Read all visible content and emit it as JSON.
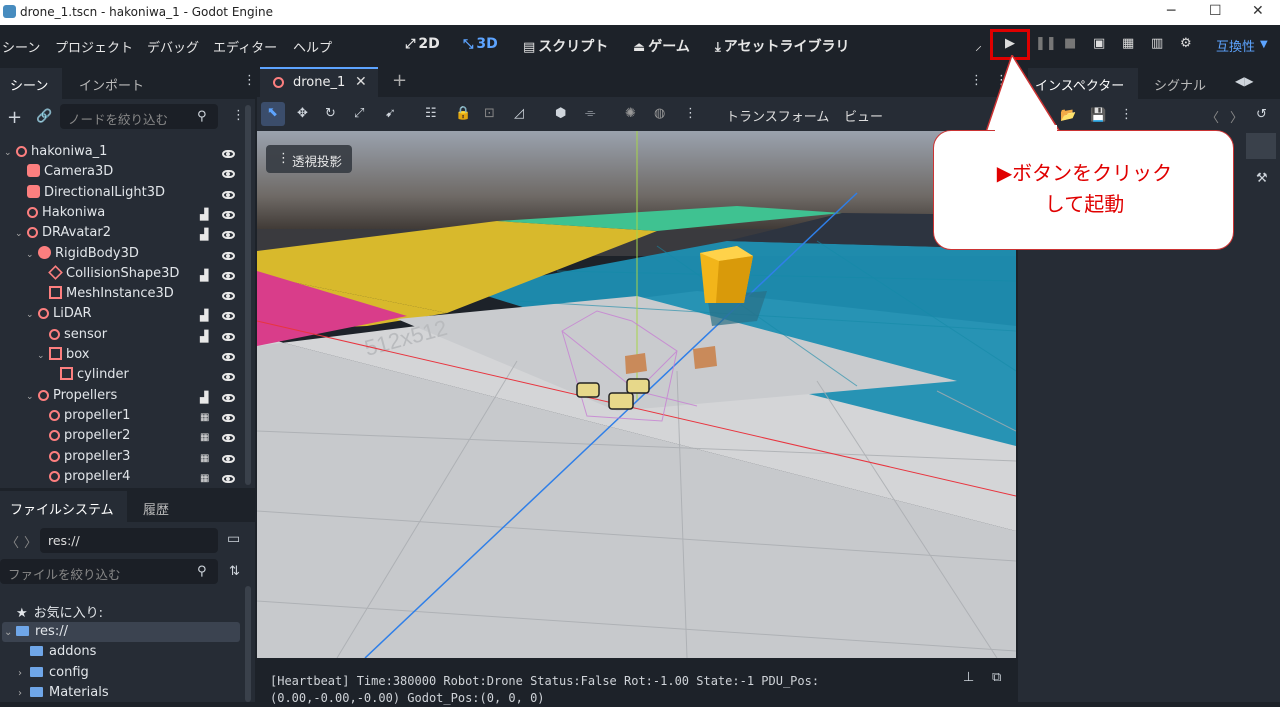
{
  "window": {
    "title": "drone_1.tscn - hakoniwa_1 - Godot Engine",
    "controls": [
      "─",
      "☐",
      "✕"
    ]
  },
  "menubar": {
    "menus": [
      "シーン",
      "プロジェクト",
      "デバッグ",
      "エディター",
      "ヘルプ"
    ],
    "workspaces": [
      "2D",
      "3D",
      "スクリプト",
      "ゲーム",
      "アセットライブラリ"
    ],
    "active_workspace": "3D",
    "renderer": "互換性"
  },
  "scene_dock": {
    "tabs": [
      "シーン",
      "インポート"
    ],
    "filter_placeholder": "ノードを絞り込む",
    "nodes": [
      {
        "name": "hakoniwa_1",
        "depth": 0,
        "icon": "node3d-icon",
        "expanded": true,
        "script": false
      },
      {
        "name": "Camera3D",
        "depth": 1,
        "icon": "camera-icon",
        "script": false
      },
      {
        "name": "DirectionalLight3D",
        "depth": 1,
        "icon": "light-icon",
        "script": false
      },
      {
        "name": "Hakoniwa",
        "depth": 1,
        "icon": "node3d-icon",
        "script": true
      },
      {
        "name": "DRAvatar2",
        "depth": 1,
        "icon": "node3d-icon",
        "expanded": true,
        "script": true
      },
      {
        "name": "RigidBody3D",
        "depth": 2,
        "icon": "rigidbody-icon",
        "expanded": true,
        "script": false
      },
      {
        "name": "CollisionShape3D",
        "depth": 3,
        "icon": "collision-icon",
        "script": true
      },
      {
        "name": "MeshInstance3D",
        "depth": 3,
        "icon": "mesh-icon",
        "script": false
      },
      {
        "name": "LiDAR",
        "depth": 2,
        "icon": "node3d-icon",
        "expanded": true,
        "script": true
      },
      {
        "name": "sensor",
        "depth": 3,
        "icon": "node3d-icon",
        "script": true
      },
      {
        "name": "box",
        "depth": 3,
        "icon": "mesh-icon",
        "expanded": true,
        "script": false
      },
      {
        "name": "cylinder",
        "depth": 4,
        "icon": "mesh-icon",
        "script": false
      },
      {
        "name": "Propellers",
        "depth": 2,
        "icon": "node3d-icon",
        "expanded": true,
        "script": true
      },
      {
        "name": "propeller1",
        "depth": 3,
        "icon": "node3d-icon",
        "scene": true
      },
      {
        "name": "propeller2",
        "depth": 3,
        "icon": "node3d-icon",
        "scene": true
      },
      {
        "name": "propeller3",
        "depth": 3,
        "icon": "node3d-icon",
        "scene": true
      },
      {
        "name": "propeller4",
        "depth": 3,
        "icon": "node3d-icon",
        "scene": true
      }
    ]
  },
  "filesystem_dock": {
    "tabs": [
      "ファイルシステム",
      "履歴"
    ],
    "path": "res://",
    "filter_placeholder": "ファイルを絞り込む",
    "favorites_label": "お気に入り:",
    "entries": [
      {
        "name": "res://",
        "depth": 0,
        "expanded": true
      },
      {
        "name": "addons",
        "depth": 1
      },
      {
        "name": "config",
        "depth": 1,
        "collapsed": true
      },
      {
        "name": "Materials",
        "depth": 1,
        "collapsed": true
      }
    ]
  },
  "editor": {
    "scene_tab": "drone_1",
    "toolbar_menus": [
      "トランスフォーム",
      "ビュー"
    ],
    "perspective_label": "透視投影",
    "floor_text": "512x512"
  },
  "inspector": {
    "tabs": [
      "インスペクター",
      "シグナル"
    ]
  },
  "console": {
    "line1": "[Heartbeat] Time:380000 Robot:Drone Status:False Rot:-1.00 State:-1 PDU_Pos:",
    "line2": "(0.00,-0.00,-0.00) Godot_Pos:(0, 0, 0)"
  },
  "callout": {
    "line1": "▶ボタンをクリック",
    "line2": "して起動"
  },
  "colors": {
    "accent": "#5da4ff",
    "highlight": "#e00000",
    "node_icon": "#fc7f7f"
  }
}
